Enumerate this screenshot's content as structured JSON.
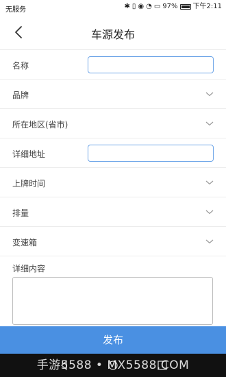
{
  "status_bar": {
    "carrier": "无服务",
    "battery": "97%",
    "time": "下午2:11"
  },
  "nav": {
    "title": "车源发布"
  },
  "form": {
    "name_label": "名称",
    "brand_label": "品牌",
    "region_label": "所在地区(省市)",
    "address_label": "详细地址",
    "plate_time_label": "上牌时间",
    "displacement_label": "排量",
    "transmission_label": "变速箱",
    "detail_label": "详细内容"
  },
  "submit_label": "发布",
  "watermark": "手游5588 • MX5588.COM"
}
